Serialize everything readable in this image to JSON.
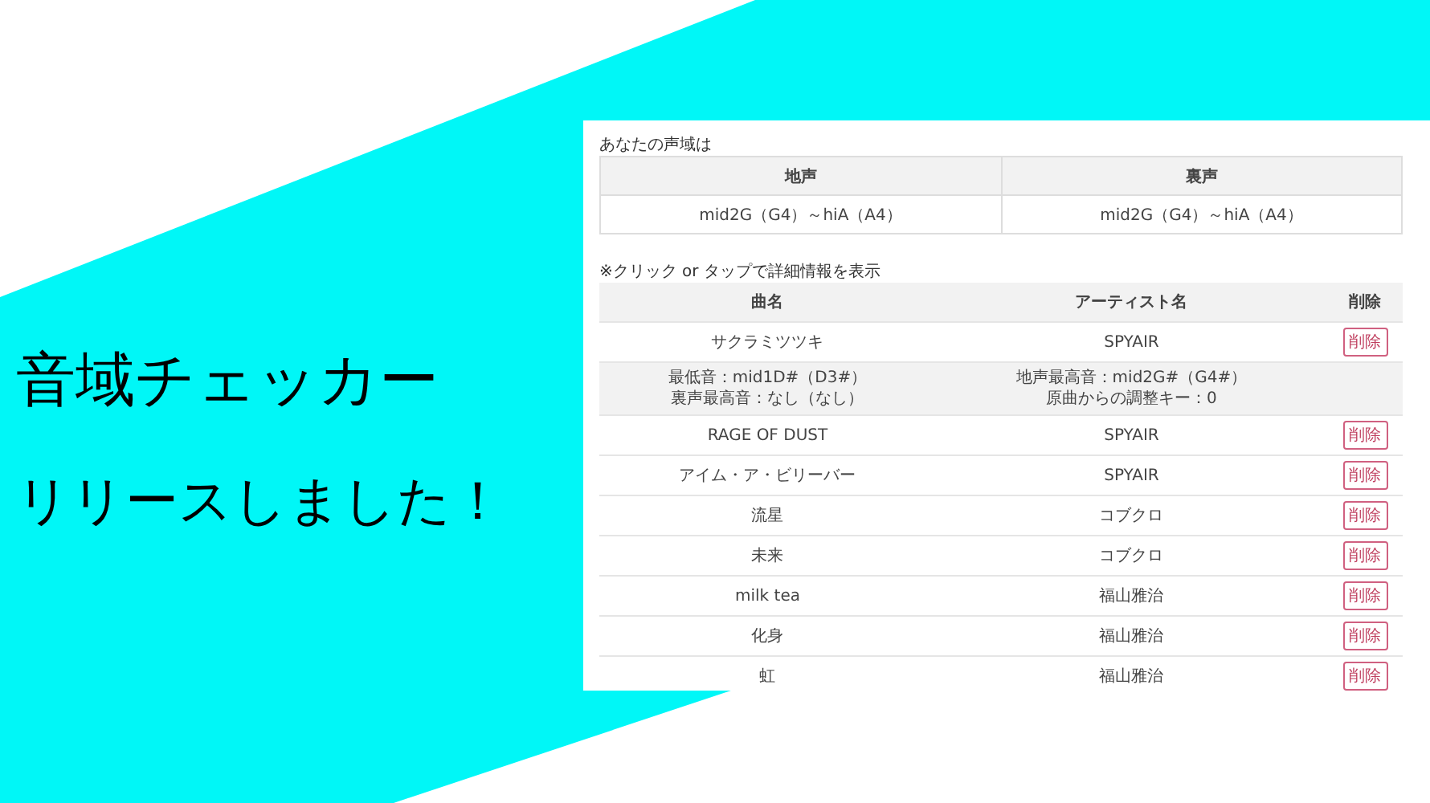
{
  "banner": {
    "headline": "音域チェッカー",
    "subline": "リリースしました！"
  },
  "range": {
    "label": "あなたの声域は",
    "columns": [
      "地声",
      "裏声"
    ],
    "values": [
      "mid2G（G4）～hiA（A4）",
      "mid2G（G4）～hiA（A4）"
    ]
  },
  "songs": {
    "note": "※クリック or タップで詳細情報を表示",
    "columns": [
      "曲名",
      "アーティスト名",
      "削除"
    ],
    "rows": [
      {
        "title": "サクラミツツキ",
        "artist": "SPYAIR",
        "delete": "削除",
        "details": [
          [
            "最低音：mid1D#（D3#）",
            "裏声最高音：なし（なし）"
          ],
          [
            "地声最高音：mid2G#（G4#）",
            "原曲からの調整キー：0"
          ]
        ]
      },
      {
        "title": "RAGE OF DUST",
        "artist": "SPYAIR",
        "delete": "削除"
      },
      {
        "title": "アイム・ア・ビリーバー",
        "artist": "SPYAIR",
        "delete": "削除"
      },
      {
        "title": "流星",
        "artist": "コブクロ",
        "delete": "削除"
      },
      {
        "title": "未来",
        "artist": "コブクロ",
        "delete": "削除"
      },
      {
        "title": "milk tea",
        "artist": "福山雅治",
        "delete": "削除"
      },
      {
        "title": "化身",
        "artist": "福山雅治",
        "delete": "削除"
      },
      {
        "title": "虹",
        "artist": "福山雅治",
        "delete": "削除"
      }
    ]
  }
}
